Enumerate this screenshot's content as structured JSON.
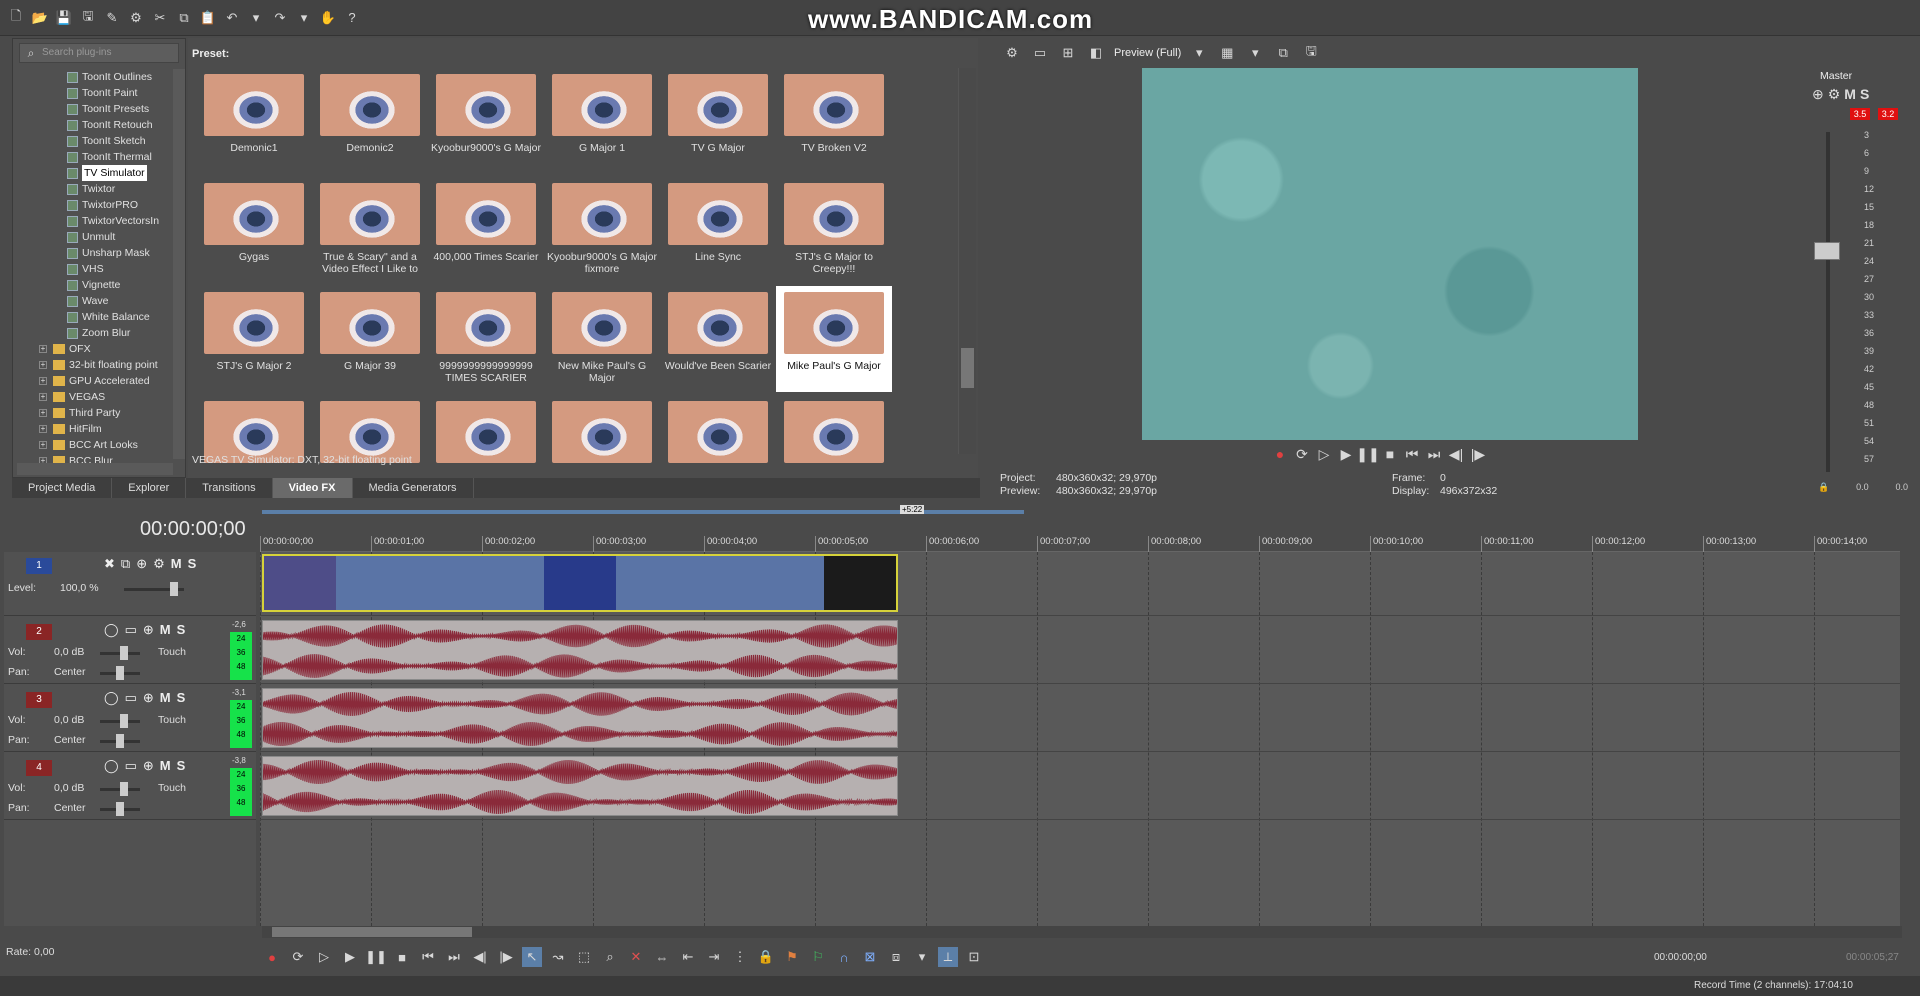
{
  "watermark": "www.BANDICAM.com",
  "plugins": {
    "search_placeholder": "Search plug-ins",
    "items": [
      {
        "label": "ToonIt Outlines",
        "kind": "leaf"
      },
      {
        "label": "ToonIt Paint",
        "kind": "leaf"
      },
      {
        "label": "ToonIt Presets",
        "kind": "leaf"
      },
      {
        "label": "ToonIt Retouch",
        "kind": "leaf"
      },
      {
        "label": "ToonIt Sketch",
        "kind": "leaf"
      },
      {
        "label": "ToonIt Thermal",
        "kind": "leaf"
      },
      {
        "label": "TV Simulator",
        "kind": "leaf",
        "selected": true
      },
      {
        "label": "Twixtor",
        "kind": "leaf"
      },
      {
        "label": "TwixtorPRO",
        "kind": "leaf"
      },
      {
        "label": "TwixtorVectorsIn",
        "kind": "leaf"
      },
      {
        "label": "Unmult",
        "kind": "leaf"
      },
      {
        "label": "Unsharp Mask",
        "kind": "leaf"
      },
      {
        "label": "VHS",
        "kind": "leaf"
      },
      {
        "label": "Vignette",
        "kind": "leaf"
      },
      {
        "label": "Wave",
        "kind": "leaf"
      },
      {
        "label": "White Balance",
        "kind": "leaf"
      },
      {
        "label": "Zoom Blur",
        "kind": "leaf"
      },
      {
        "label": "OFX",
        "kind": "folder"
      },
      {
        "label": "32-bit floating point",
        "kind": "folder"
      },
      {
        "label": "GPU Accelerated",
        "kind": "folder"
      },
      {
        "label": "VEGAS",
        "kind": "folder"
      },
      {
        "label": "Third Party",
        "kind": "folder"
      },
      {
        "label": "HitFilm",
        "kind": "folder"
      },
      {
        "label": "BCC Art Looks",
        "kind": "folder"
      },
      {
        "label": "BCC Blur",
        "kind": "folder"
      }
    ]
  },
  "preset": {
    "label": "Preset:",
    "items": [
      "Demonic1",
      "Demonic2",
      "Kyoobur9000's G Major",
      "G Major 1",
      "TV G Major",
      "TV Broken V2",
      "Gygas",
      "True & Scary\" and a Video Effect I Like to",
      "400,000 Times Scarier",
      "Kyoobur9000's G Major fixmore",
      "Line Sync",
      "STJ's G Major to Creepy!!!",
      "STJ's G Major 2",
      "G Major 39",
      "9999999999999999 TIMES SCARIER",
      "New Mike Paul's G Major",
      "Would've Been Scarier",
      "Mike Paul's G Major",
      "",
      "",
      "",
      "",
      "",
      ""
    ],
    "selected_index": 17,
    "description": "VEGAS TV Simulator: DXT, 32-bit floating point"
  },
  "tabs": [
    "Project Media",
    "Explorer",
    "Transitions",
    "Video FX",
    "Media Generators"
  ],
  "active_tab": 3,
  "preview": {
    "mode": "Preview (Full)",
    "project_label": "Project:",
    "project_value": "480x360x32; 29,970p",
    "preview_label": "Preview:",
    "preview_value": "480x360x32; 29,970p",
    "frame_label": "Frame:",
    "frame_value": "0",
    "display_label": "Display:",
    "display_value": "496x372x32"
  },
  "master": {
    "title": "Master",
    "peak_left": "3.5",
    "peak_right": "3.2",
    "ticks": [
      "3",
      "6",
      "9",
      "12",
      "15",
      "18",
      "21",
      "24",
      "27",
      "30",
      "33",
      "36",
      "39",
      "42",
      "45",
      "48",
      "51",
      "54",
      "57"
    ],
    "bottom_left": "0.0",
    "bottom_right": "0.0"
  },
  "timeline": {
    "timecode": "00:00:00;00",
    "loop_label": "+5:22",
    "ruler": [
      "00:00:00;00",
      "00:00:01;00",
      "00:00:02;00",
      "00:00:03;00",
      "00:00:04;00",
      "00:00:05;00",
      "00:00:06;00",
      "00:00:07;00",
      "00:00:08;00",
      "00:00:09;00",
      "00:00:10;00",
      "00:00:11;00",
      "00:00:12;00",
      "00:00:13;00",
      "00:00:14;00"
    ],
    "tracks": [
      {
        "num": "1",
        "type": "video",
        "level_label": "Level:",
        "level_value": "100,0 %"
      },
      {
        "num": "2",
        "type": "audio",
        "vol_label": "Vol:",
        "vol_value": "0,0 dB",
        "pan_label": "Pan:",
        "pan_value": "Center",
        "touch": "Touch",
        "peak": "-2,6"
      },
      {
        "num": "3",
        "type": "audio",
        "vol_label": "Vol:",
        "vol_value": "0,0 dB",
        "pan_label": "Pan:",
        "pan_value": "Center",
        "touch": "Touch",
        "peak": "-3,1"
      },
      {
        "num": "4",
        "type": "audio",
        "vol_label": "Vol:",
        "vol_value": "0,0 dB",
        "pan_label": "Pan:",
        "pan_value": "Center",
        "touch": "Touch",
        "peak": "-3,8"
      }
    ],
    "meter_ticks": [
      "24",
      "36",
      "48"
    ]
  },
  "bottom": {
    "rate": "Rate: 0,00",
    "cursor_time": "00:00:00;00",
    "end_time": "00:00:05;27",
    "record_time": "Record Time (2 channels): 17:04:10"
  }
}
